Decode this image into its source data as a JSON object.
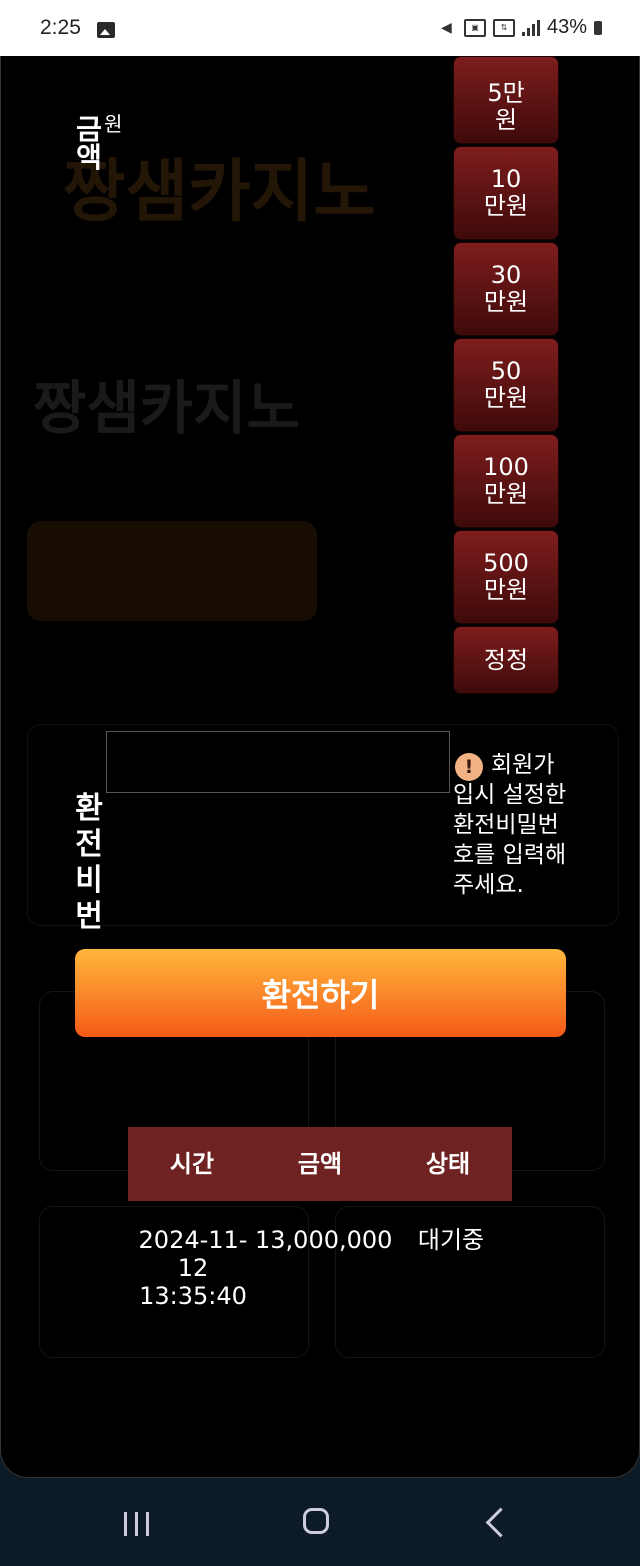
{
  "status_bar": {
    "time": "2:25",
    "battery": "43%",
    "icons": [
      "image-icon",
      "mute-icon",
      "volte-icon",
      "data-icon",
      "signal-icon",
      "battery-icon"
    ]
  },
  "background": {
    "logo": "짱샘카지노",
    "logo2": "짱샘카지노"
  },
  "amount": {
    "label": "금액",
    "label_fragment": "원",
    "buttons": [
      "5만\n원",
      "10\n만원",
      "30\n만원",
      "50\n만원",
      "100\n만원",
      "500\n만원"
    ],
    "reset_label": "정정"
  },
  "password": {
    "label": "환전비번",
    "value": "",
    "notice_icon": "!",
    "notice": "회원가입시 설정한 환전비밀번호를 입력해주세요."
  },
  "submit_label": "환전하기",
  "history": {
    "headers": [
      "시간",
      "금액",
      "상태"
    ],
    "rows": [
      {
        "time": "2024-11-12 13:35:40",
        "amount": "13,000,000",
        "status": "대기중"
      }
    ]
  },
  "colors": {
    "accent_orange_top": "#ffb73d",
    "accent_orange_bottom": "#f65a18",
    "amount_button": "#7e1d1d",
    "table_header": "#6e2222"
  }
}
